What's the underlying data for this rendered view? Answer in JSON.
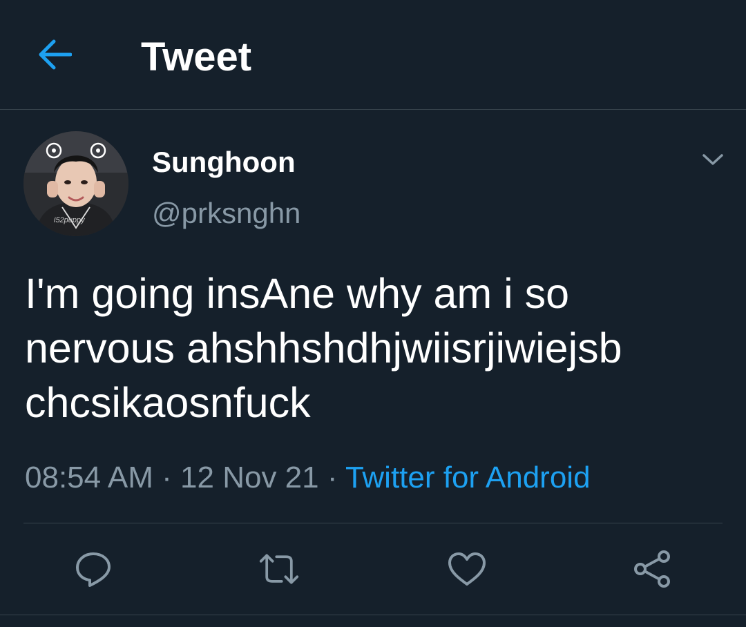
{
  "header": {
    "back_icon": "arrow-left-icon",
    "title": "Tweet"
  },
  "author": {
    "name": "Sunghoon",
    "handle": "@prksnghn",
    "avatar_watermark": "i52puppy"
  },
  "tweet": {
    "lines": [
      "I'm going insAne why am i so",
      "nervous ahshhshdhjwiisrjiwiejsb",
      "chcsikaosnfuck"
    ]
  },
  "meta": {
    "time": "08:54 AM",
    "separator": "·",
    "date": "12 Nov 21",
    "source": "Twitter for Android"
  },
  "actions": [
    {
      "icon": "reply-icon"
    },
    {
      "icon": "retweet-icon"
    },
    {
      "icon": "like-icon"
    },
    {
      "icon": "share-icon"
    }
  ],
  "colors": {
    "background": "#15202b",
    "accent": "#1da1f2",
    "secondary_text": "#8899a6",
    "divider": "#38444d"
  }
}
